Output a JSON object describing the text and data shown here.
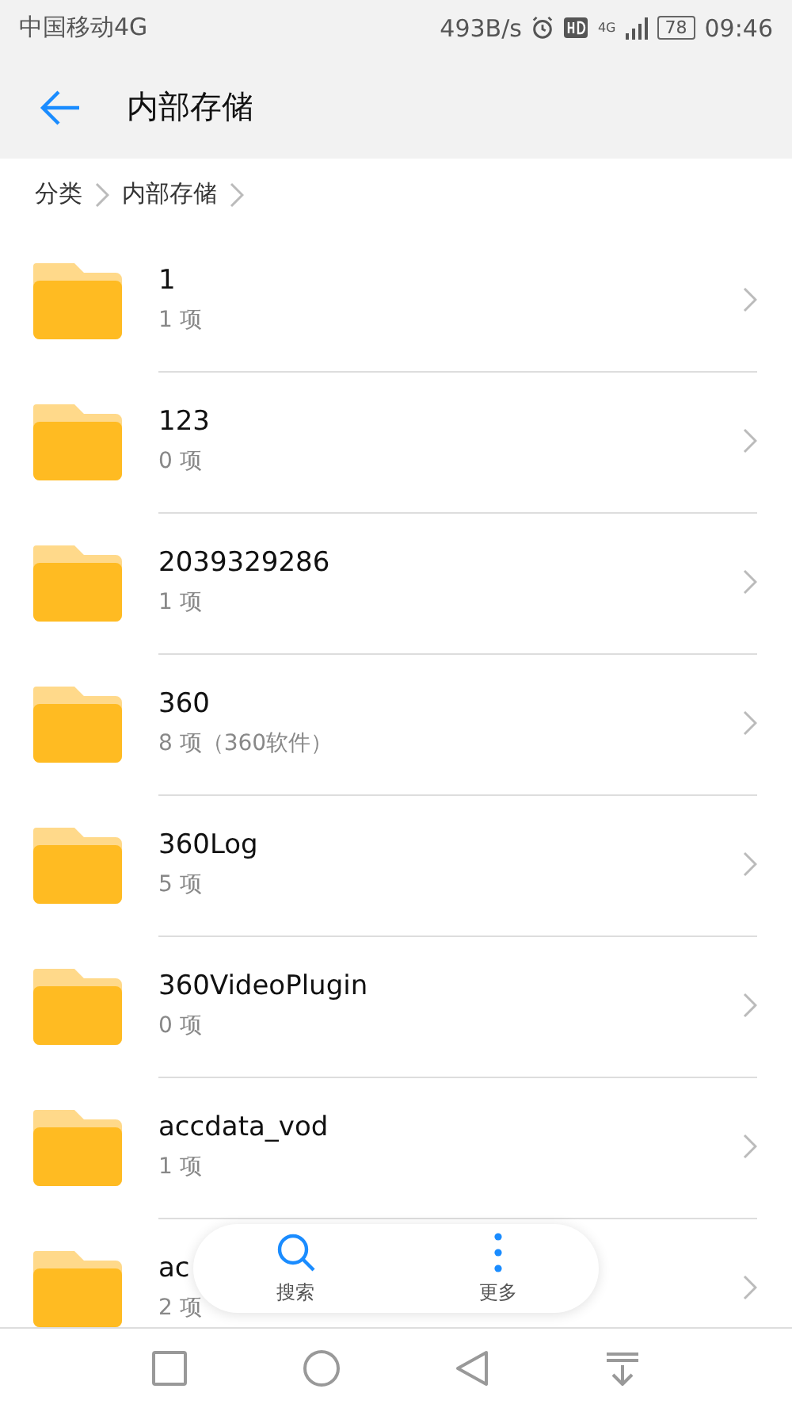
{
  "status_bar": {
    "carrier": "中国移动4G",
    "speed": "493B/s",
    "network": "4G",
    "battery": "78",
    "time": "09:46"
  },
  "header": {
    "title": "内部存储"
  },
  "breadcrumb": [
    "分类",
    "内部存储"
  ],
  "folders": [
    {
      "name": "1",
      "info": "1 项"
    },
    {
      "name": "123",
      "info": "0 项"
    },
    {
      "name": "2039329286",
      "info": "1 项"
    },
    {
      "name": "360",
      "info": "8 项（360软件）"
    },
    {
      "name": "360Log",
      "info": "5 项"
    },
    {
      "name": "360VideoPlugin",
      "info": "0 项"
    },
    {
      "name": "accdata_vod",
      "info": "1 项"
    },
    {
      "name": "ac",
      "info": "2 项"
    }
  ],
  "actions": [
    {
      "kind": "search",
      "label": "搜索"
    },
    {
      "kind": "more",
      "label": "更多"
    }
  ]
}
